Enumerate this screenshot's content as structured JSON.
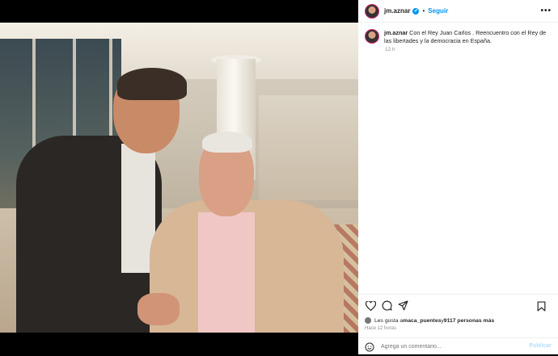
{
  "post": {
    "username": "jm.aznar",
    "verified_glyph": "✔",
    "separator": "•",
    "follow_label": "Seguir",
    "more_label": "•••",
    "caption_username": "jm.aznar",
    "caption_text": "Con el Rey Juan Carlos . Reencuentro con el Rey de las libertades y la democracia en España.",
    "caption_time": "12 h"
  },
  "engagement": {
    "likes_prefix": "Les gusta a ",
    "likes_user": "maca_puentes",
    "likes_middle": " y ",
    "likes_count": "9117 personas más",
    "time_ago": "Hace 12 horas"
  },
  "comment": {
    "placeholder": "Agrega un comentario...",
    "publish_label": "Publicar"
  },
  "icons": {
    "like": "heart-icon",
    "comment": "comment-icon",
    "share": "share-icon",
    "save": "bookmark-icon",
    "emoji": "emoji-icon"
  },
  "colors": {
    "accent": "#0095f6",
    "publish_disabled": "#b2dffc",
    "muted": "#8e8e8e"
  }
}
